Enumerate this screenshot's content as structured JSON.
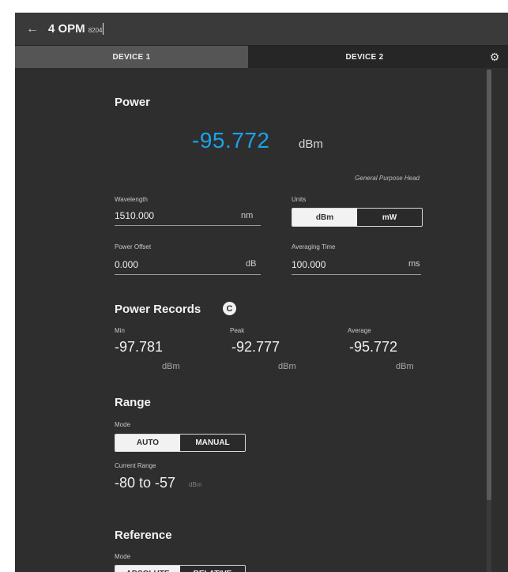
{
  "header": {
    "back_icon": "arrow-left-icon",
    "title": "4 OPM",
    "subtitle": "8204"
  },
  "tabs": [
    {
      "label": "DEVICE 1"
    },
    {
      "label": "DEVICE 2"
    }
  ],
  "settings_icon": "gear-icon",
  "power": {
    "heading": "Power",
    "reading": "-95.772",
    "reading_unit": "dBm",
    "reading_color": "#1aa3e8",
    "detector_type": "General Purpose Head",
    "wavelength": {
      "label": "Wavelength",
      "value": "1510.000",
      "unit": "nm"
    },
    "units": {
      "label": "Units",
      "options": [
        "dBm",
        "mW"
      ],
      "selected": "dBm"
    },
    "power_offset": {
      "label": "Power Offset",
      "value": "0.000",
      "unit": "dB"
    },
    "averaging_time": {
      "label": "Averaging Time",
      "value": "100.000",
      "unit": "ms"
    }
  },
  "power_records": {
    "heading": "Power Records",
    "refresh_icon": "refresh-icon",
    "refresh_glyph": "C",
    "items": [
      {
        "label": "Min",
        "value": "-97.781",
        "unit": "dBm"
      },
      {
        "label": "Peak",
        "value": "-92.777",
        "unit": "dBm"
      },
      {
        "label": "Average",
        "value": "-95.772",
        "unit": "dBm"
      }
    ]
  },
  "range": {
    "heading": "Range",
    "mode_label": "Mode",
    "mode_options": [
      "AUTO",
      "MANUAL"
    ],
    "mode_selected": "AUTO",
    "current_label": "Current Range",
    "current_value": "-80 to -57",
    "current_unit": "dBm"
  },
  "reference": {
    "heading": "Reference",
    "mode_label": "Mode",
    "mode_options": [
      "ABSOLUTE",
      "RELATIVE"
    ],
    "mode_selected": "ABSOLUTE"
  }
}
